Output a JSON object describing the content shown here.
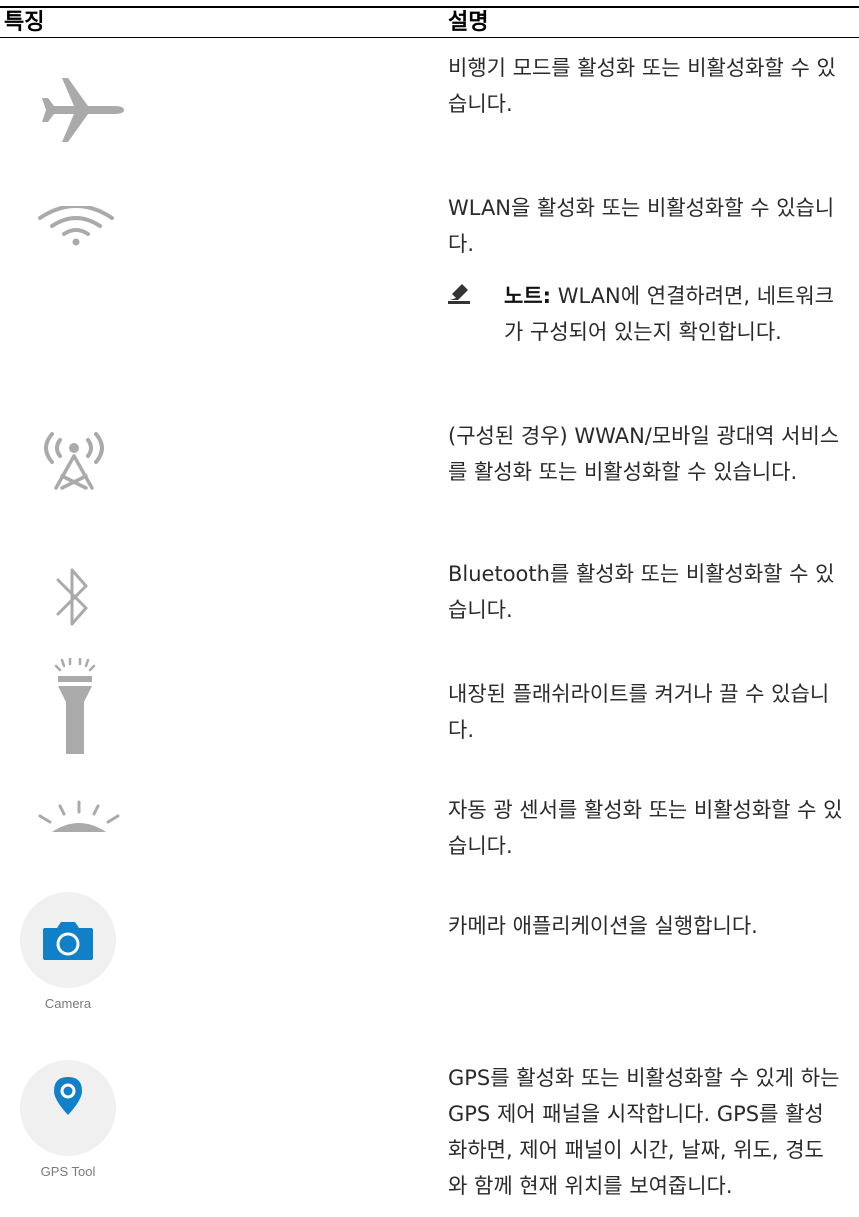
{
  "table": {
    "header": {
      "feature": "특징",
      "description": "설명"
    },
    "rows": [
      {
        "icon": "airplane-icon",
        "description": "비행기 모드를 활성화 또는 비활성화할 수 있습니다."
      },
      {
        "icon": "wifi-icon",
        "description": "WLAN을 활성화 또는 비활성화할 수 있습니다.",
        "note": {
          "label": "노트:",
          "text": "WLAN에 연결하려면, 네트워크가 구성되어 있는지 확인합니다."
        }
      },
      {
        "icon": "cellular-tower-icon",
        "description": "(구성된 경우) WWAN/모바일 광대역 서비스를 활성화 또는 비활성화할 수 있습니다."
      },
      {
        "icon": "bluetooth-icon",
        "description": "Bluetooth를 활성화 또는 비활성화할 수 있습니다."
      },
      {
        "icon": "flashlight-icon",
        "description": "내장된 플래쉬라이트를 켜거나 끌 수 있습니다."
      },
      {
        "icon": "ambient-light-sensor-icon",
        "description": "자동 광 센서를 활성화 또는 비활성화할 수 있습니다."
      },
      {
        "icon": "camera-icon",
        "caption": "Camera",
        "description": "카메라 애플리케이션을 실행합니다."
      },
      {
        "icon": "gps-pin-icon",
        "caption": "GPS Tool",
        "description": "GPS를 활성화 또는 비활성화할 수 있게 하는 GPS 제어 패널을 시작합니다. GPS를 활성화하면, 제어 패널이 시간, 날짜, 위도, 경도와 함께 현재 위치를 보여줍니다."
      }
    ]
  },
  "colors": {
    "icon_gray": "#aaaaaa",
    "accent_blue": "#1080c8",
    "rule": "#000000"
  }
}
